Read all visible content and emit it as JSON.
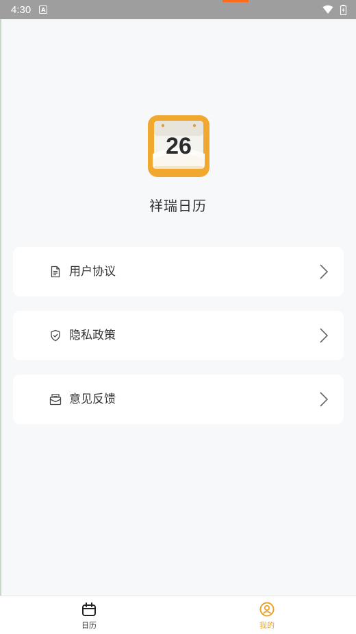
{
  "status_bar": {
    "time": "4:30",
    "a_icon_text": "A"
  },
  "app": {
    "logo_day": "26",
    "name": "祥瑞日历"
  },
  "menu": [
    {
      "label": "用户协议",
      "icon": "document-icon"
    },
    {
      "label": "隐私政策",
      "icon": "shield-check-icon"
    },
    {
      "label": "意见反馈",
      "icon": "mail-open-icon"
    }
  ],
  "tabs": [
    {
      "label": "日历",
      "icon": "calendar-icon",
      "active": false
    },
    {
      "label": "我的",
      "icon": "user-circle-icon",
      "active": true
    }
  ],
  "colors": {
    "accent": "#e9a42b",
    "background": "#f7f8fa",
    "card": "#ffffff",
    "status_bar": "#9e9e9e"
  }
}
